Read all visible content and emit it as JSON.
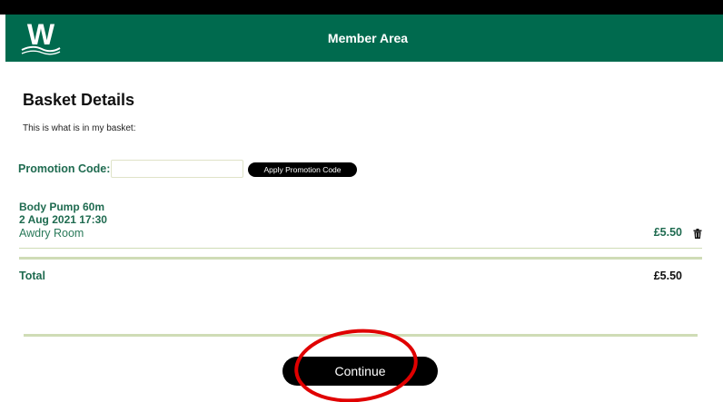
{
  "header": {
    "logo_letter": "W",
    "title": "Member Area",
    "color": "#006a4e"
  },
  "basket": {
    "title": "Basket Details",
    "intro": "This is what is in my basket:"
  },
  "promotion": {
    "label": "Promotion Code:",
    "input_value": "",
    "button_label": "Apply Promotion Code"
  },
  "items": [
    {
      "name": "Body Pump 60m",
      "date": "2 Aug 2021 17:30",
      "room": "Awdry Room",
      "price": "£5.50",
      "remove_icon": "trash-icon"
    }
  ],
  "total": {
    "label": "Total",
    "value": "£5.50"
  },
  "actions": {
    "continue_label": "Continue"
  },
  "annotation": {
    "type": "red-circle",
    "color": "#e00000",
    "target": "continue-button"
  }
}
